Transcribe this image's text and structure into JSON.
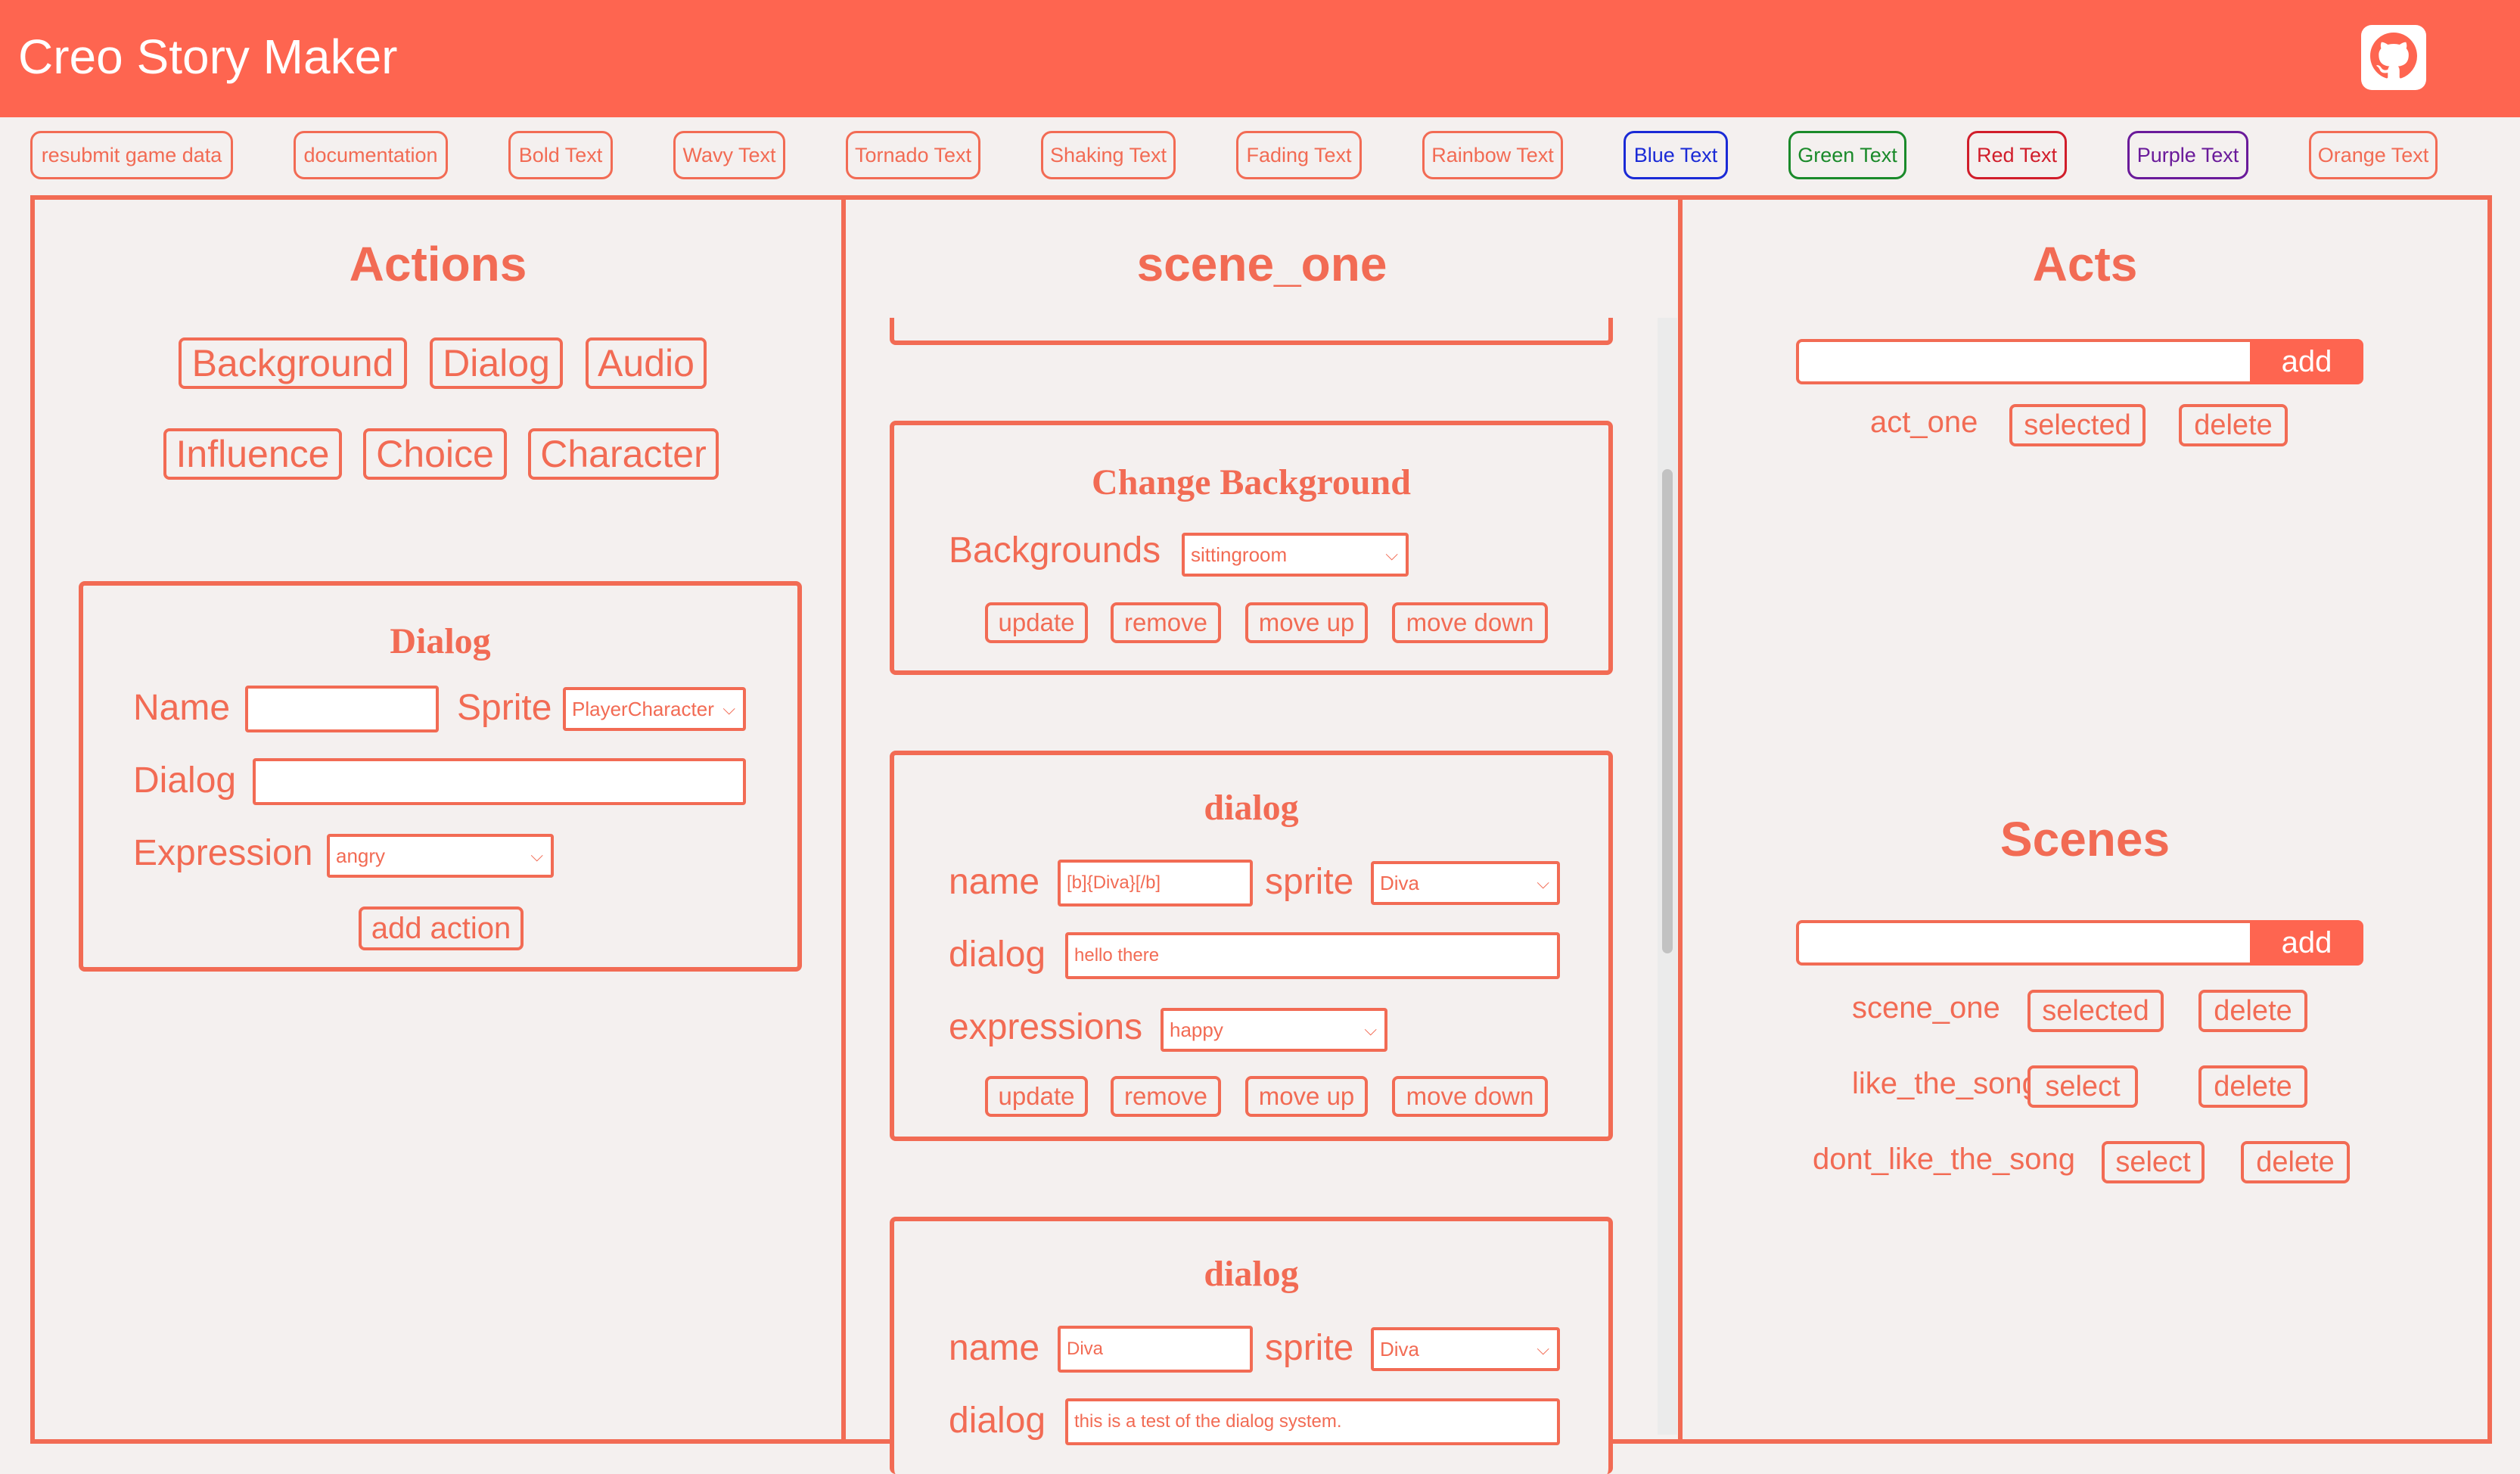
{
  "app": {
    "title": "Creo Story Maker",
    "github_icon": "github-icon"
  },
  "toolbar": [
    {
      "label": "resubmit game data",
      "color": "#f26b54"
    },
    {
      "label": "documentation",
      "color": "#f26b54"
    },
    {
      "label": "Bold Text",
      "color": "#f26b54"
    },
    {
      "label": "Wavy Text",
      "color": "#f26b54"
    },
    {
      "label": "Tornado Text",
      "color": "#f26b54"
    },
    {
      "label": "Shaking Text",
      "color": "#f26b54"
    },
    {
      "label": "Fading Text",
      "color": "#f26b54"
    },
    {
      "label": "Rainbow Text",
      "color": "#f26b54"
    },
    {
      "label": "Blue Text",
      "color": "#1a2ad6"
    },
    {
      "label": "Green Text",
      "color": "#1a8a2a"
    },
    {
      "label": "Red Text",
      "color": "#d11d2a"
    },
    {
      "label": "Purple Text",
      "color": "#6a1a9a"
    },
    {
      "label": "Orange Text",
      "color": "#f26b54"
    }
  ],
  "actions": {
    "title": "Actions",
    "buttons": [
      "Background",
      "Dialog",
      "Audio",
      "Influence",
      "Choice",
      "Character"
    ],
    "form": {
      "title": "Dialog",
      "name_label": "Name",
      "name_value": "",
      "sprite_label": "Sprite",
      "sprite_value": "PlayerCharacter",
      "dialog_label": "Dialog",
      "dialog_value": "",
      "expression_label": "Expression",
      "expression_value": "angry",
      "add_label": "add action"
    }
  },
  "scene": {
    "title": "scene_one",
    "cards": {
      "background": {
        "title": "Change Background",
        "bg_label": "Backgrounds",
        "bg_value": "sittingroom",
        "update": "update",
        "remove": "remove",
        "move_up": "move up",
        "move_down": "move down"
      },
      "dialog1": {
        "title": "dialog",
        "name_label": "name",
        "name_value": "[b]{Diva}[/b]",
        "sprite_label": "sprite",
        "sprite_value": "Diva",
        "dialog_label": "dialog",
        "dialog_value": "hello there",
        "expr_label": "expressions",
        "expr_value": "happy",
        "update": "update",
        "remove": "remove",
        "move_up": "move up",
        "move_down": "move down"
      },
      "dialog2": {
        "title": "dialog",
        "name_label": "name",
        "name_value": "Diva",
        "sprite_label": "sprite",
        "sprite_value": "Diva",
        "dialog_label": "dialog",
        "dialog_value": "this is a test of the dialog system."
      }
    }
  },
  "acts": {
    "title": "Acts",
    "add_label": "add",
    "input_value": "",
    "items": [
      {
        "name": "act_one",
        "state": "selected",
        "delete": "delete"
      }
    ]
  },
  "scenes": {
    "title": "Scenes",
    "add_label": "add",
    "input_value": "",
    "items": [
      {
        "name": "scene_one",
        "state": "selected",
        "delete": "delete"
      },
      {
        "name": "like_the_song",
        "state": "select",
        "delete": "delete"
      },
      {
        "name": "dont_like_the_song",
        "state": "select",
        "delete": "delete"
      }
    ]
  }
}
